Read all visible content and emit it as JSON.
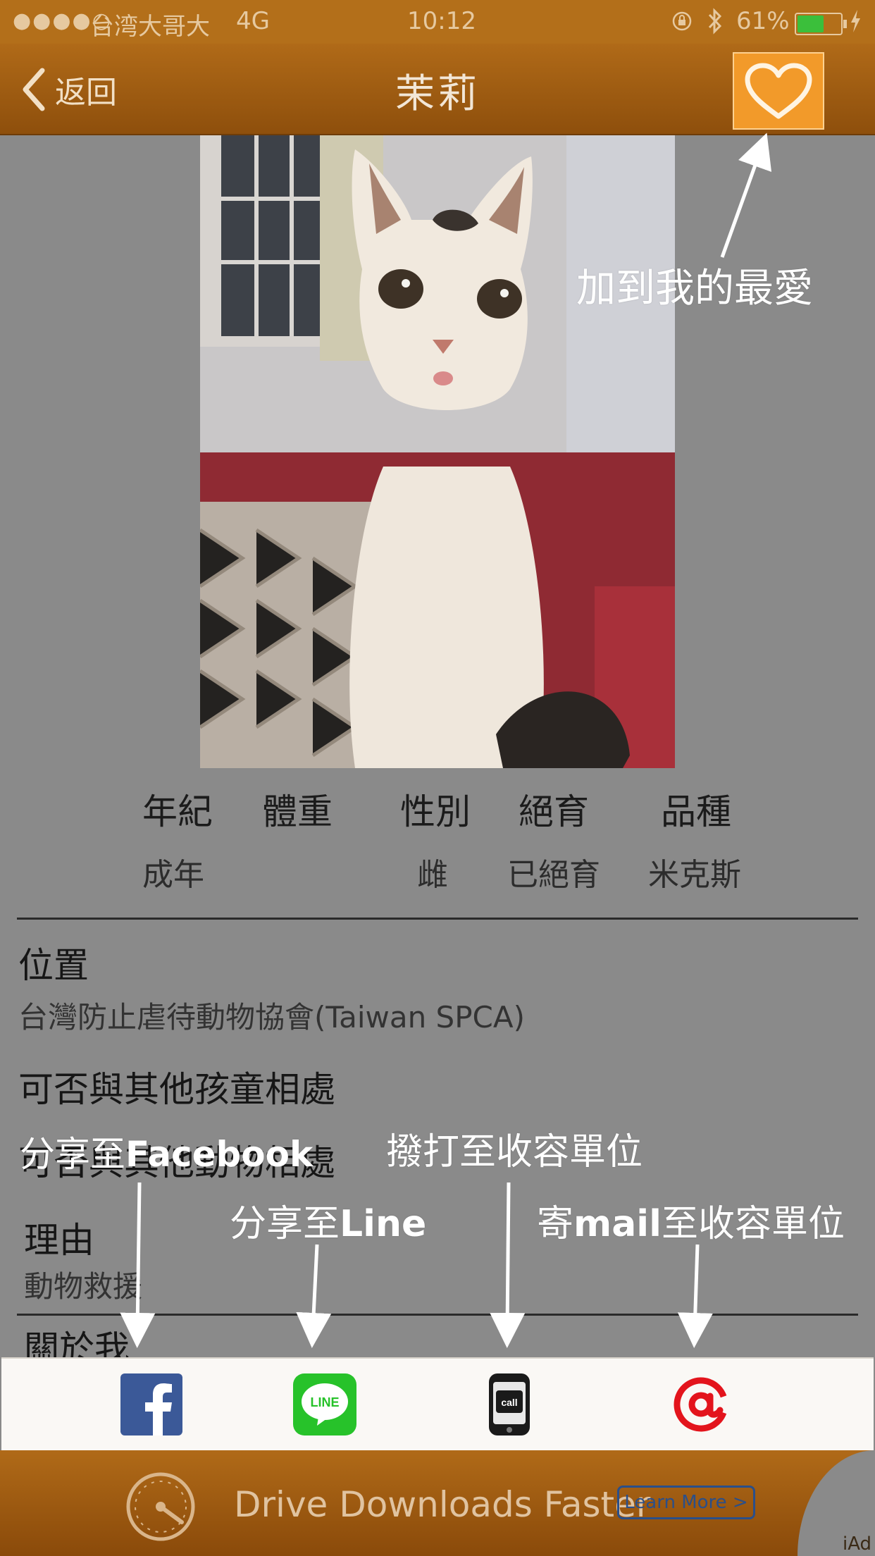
{
  "status_bar": {
    "carrier": "台湾大哥大",
    "network": "4G",
    "time": "10:12",
    "battery_percent": "61%",
    "battery_level": 0.61,
    "signal_dots": "●●●●○"
  },
  "nav": {
    "back_label": "返回",
    "title": "茉莉"
  },
  "stats": [
    {
      "label": "年紀",
      "value": "成年"
    },
    {
      "label": "體重",
      "value": ""
    },
    {
      "label": "性別",
      "value": "雌"
    },
    {
      "label": "絕育",
      "value": "已絕育"
    },
    {
      "label": "品種",
      "value": "米克斯"
    }
  ],
  "details": {
    "location_heading": "位置",
    "location_value": "台灣防止虐待動物協會(Taiwan SPCA)",
    "children_heading": "可否與其他孩童相處",
    "animals_heading": "可否與其他動物相處",
    "reason_heading": "理由",
    "reason_value": "動物救援",
    "about_heading": "關於我"
  },
  "annotations": {
    "favorite": "加到我的最愛",
    "facebook_prefix": "分享至",
    "facebook_brand": "Facebook",
    "line_prefix": "分享至",
    "line_brand": "Line",
    "call": "撥打至收容單位",
    "mail_prefix": "寄",
    "mail_word": "mail",
    "mail_suffix": "至收容單位"
  },
  "share_icons": {
    "facebook": "facebook-icon",
    "line": "line-icon",
    "line_text": "LINE",
    "call": "phone-call-icon",
    "call_text": "call",
    "email": "at-sign-icon"
  },
  "ad": {
    "text": "Drive Downloads Faster",
    "button": "Learn More >",
    "badge": "iAd"
  },
  "colors": {
    "nav_brown": "#9a5a12",
    "favorite_orange": "#f29a2a",
    "facebook_blue": "#3b5998",
    "line_green": "#27c22a",
    "mail_red": "#e3141c"
  }
}
